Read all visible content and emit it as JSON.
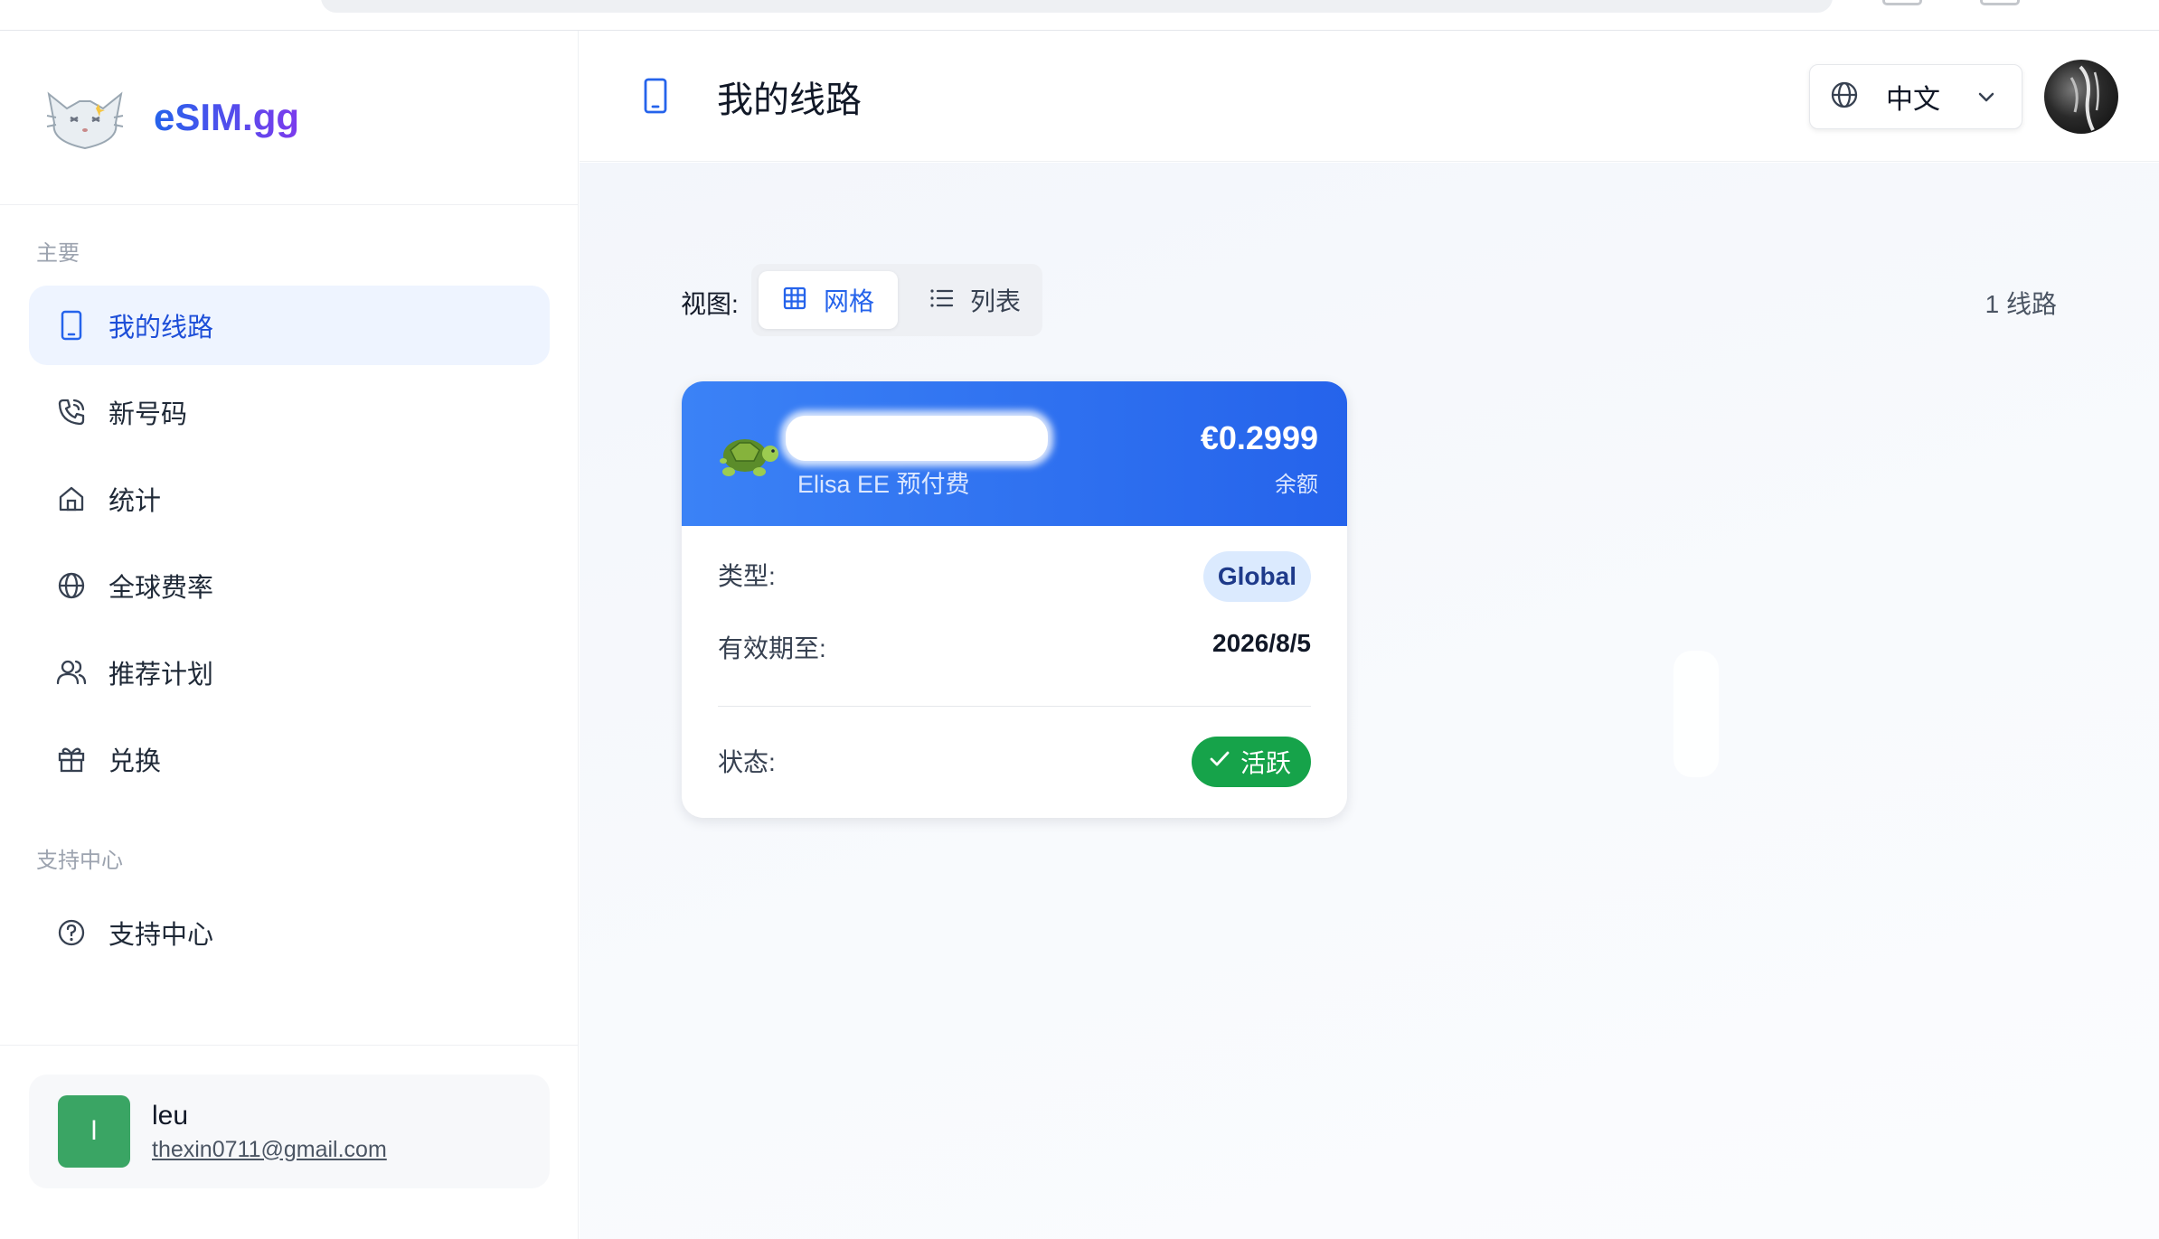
{
  "brand": {
    "name": "eSIM.gg"
  },
  "sidebar": {
    "section_main": "主要",
    "items": [
      {
        "label": "我的线路",
        "icon": "phone-icon",
        "active": true
      },
      {
        "label": "新号码",
        "icon": "phone-call-icon"
      },
      {
        "label": "统计",
        "icon": "home-icon"
      },
      {
        "label": "全球费率",
        "icon": "globe-icon"
      },
      {
        "label": "推荐计划",
        "icon": "users-icon"
      },
      {
        "label": "兑换",
        "icon": "gift-icon"
      }
    ],
    "section_support": "支持中心",
    "support_items": [
      {
        "label": "支持中心",
        "icon": "help-circle-icon"
      }
    ]
  },
  "user": {
    "initial": "l",
    "name": "leu",
    "email": "thexin0711@gmail.com"
  },
  "header": {
    "title": "我的线路",
    "language": "中文"
  },
  "main": {
    "view_label": "视图:",
    "view_grid": "网格",
    "view_list": "列表",
    "count": "1 线路"
  },
  "card": {
    "carrier": "Elisa EE 预付费",
    "balance": "€0.2999",
    "balance_label": "余额",
    "type_label": "类型:",
    "type_value": "Global",
    "expiry_label": "有效期至:",
    "expiry_value": "2026/8/5",
    "status_label": "状态:",
    "status_value": "活跃"
  },
  "colors": {
    "accent": "#2563eb",
    "active_nav_bg": "#eef4ff",
    "status_green": "#16a34a",
    "avatar_green": "#3aa564"
  }
}
